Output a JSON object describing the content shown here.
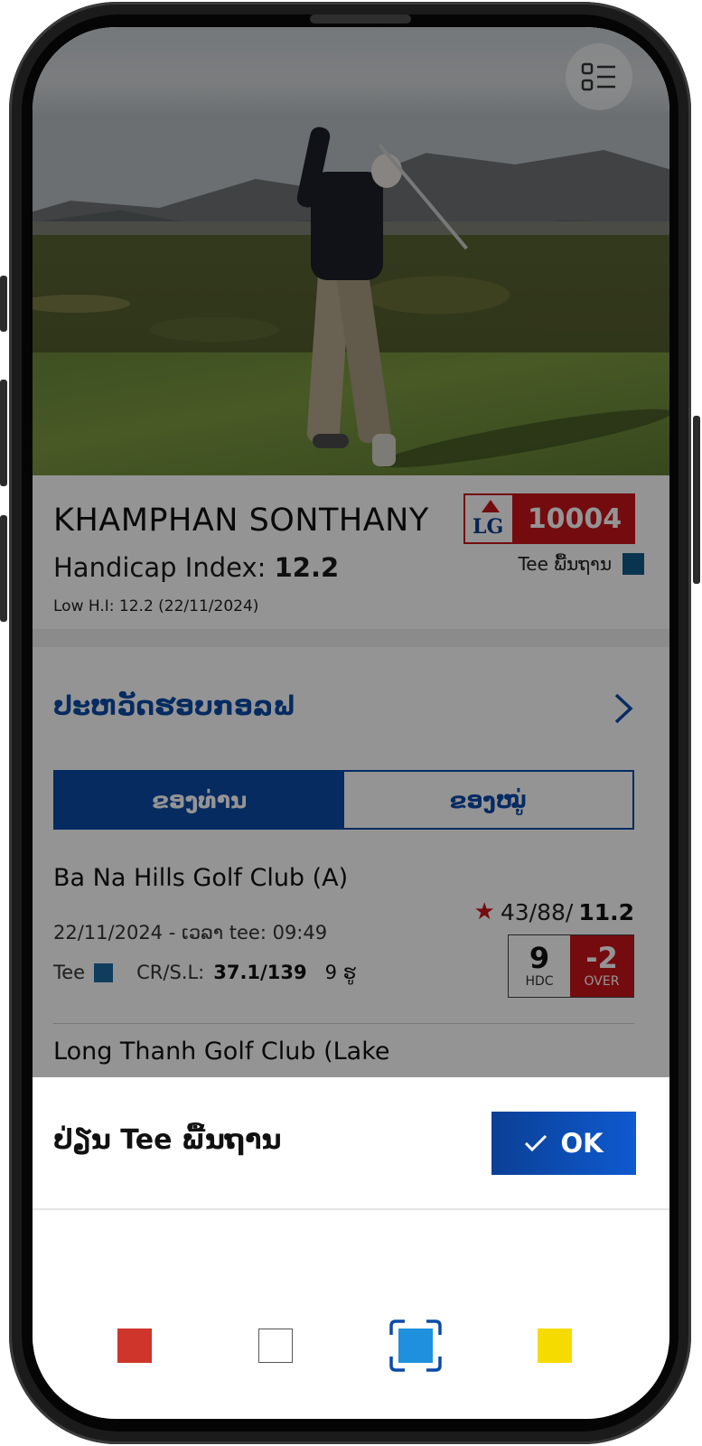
{
  "player": {
    "name": "KHAMPHAN SONTHANY",
    "handicap_label": "Handicap Index:",
    "handicap_value": "12.2",
    "low_hi": "Low H.I: 12.2 (22/11/2024)",
    "member_id": "10004",
    "badge_logo_text": "LG",
    "tee_default_label": "Tee ພື້ນຖານ"
  },
  "history": {
    "title": "ປະຫວັດຮອບກອລຟ"
  },
  "tabs": [
    {
      "label": "ຂອງທ່ານ",
      "active": true
    },
    {
      "label": "ຂອງໝູ່",
      "active": false
    }
  ],
  "rounds": [
    {
      "club": "Ba Na Hills Golf Club (A)",
      "date_time": "22/11/2024 - ເວລາ tee: 09:49",
      "tee_label": "Tee",
      "crsl_label": "CR/S.L:",
      "crsl_value": "37.1/139",
      "holes": "9 ຮູ",
      "stats_plain": "43/88/",
      "stats_bold": "11.2",
      "hdc_value": "9",
      "hdc_label": "HDC",
      "over_value": "-2",
      "over_label": "OVER"
    },
    {
      "club": "Long Thanh Golf Club (Lake"
    }
  ],
  "sheet": {
    "title": "ປ່ຽນ Tee ພື້ນຖານ",
    "ok_label": "OK",
    "swatches": [
      {
        "color": "#d0352b",
        "name": "red"
      },
      {
        "color": "#ffffff",
        "name": "white"
      },
      {
        "color": "#1e90dd",
        "name": "blue",
        "selected": true
      },
      {
        "color": "#f6db00",
        "name": "yellow"
      }
    ]
  },
  "colors": {
    "brand_blue": "#0b4aa8",
    "brand_red": "#c8151b",
    "default_tee_color": "#0f5a8a"
  }
}
